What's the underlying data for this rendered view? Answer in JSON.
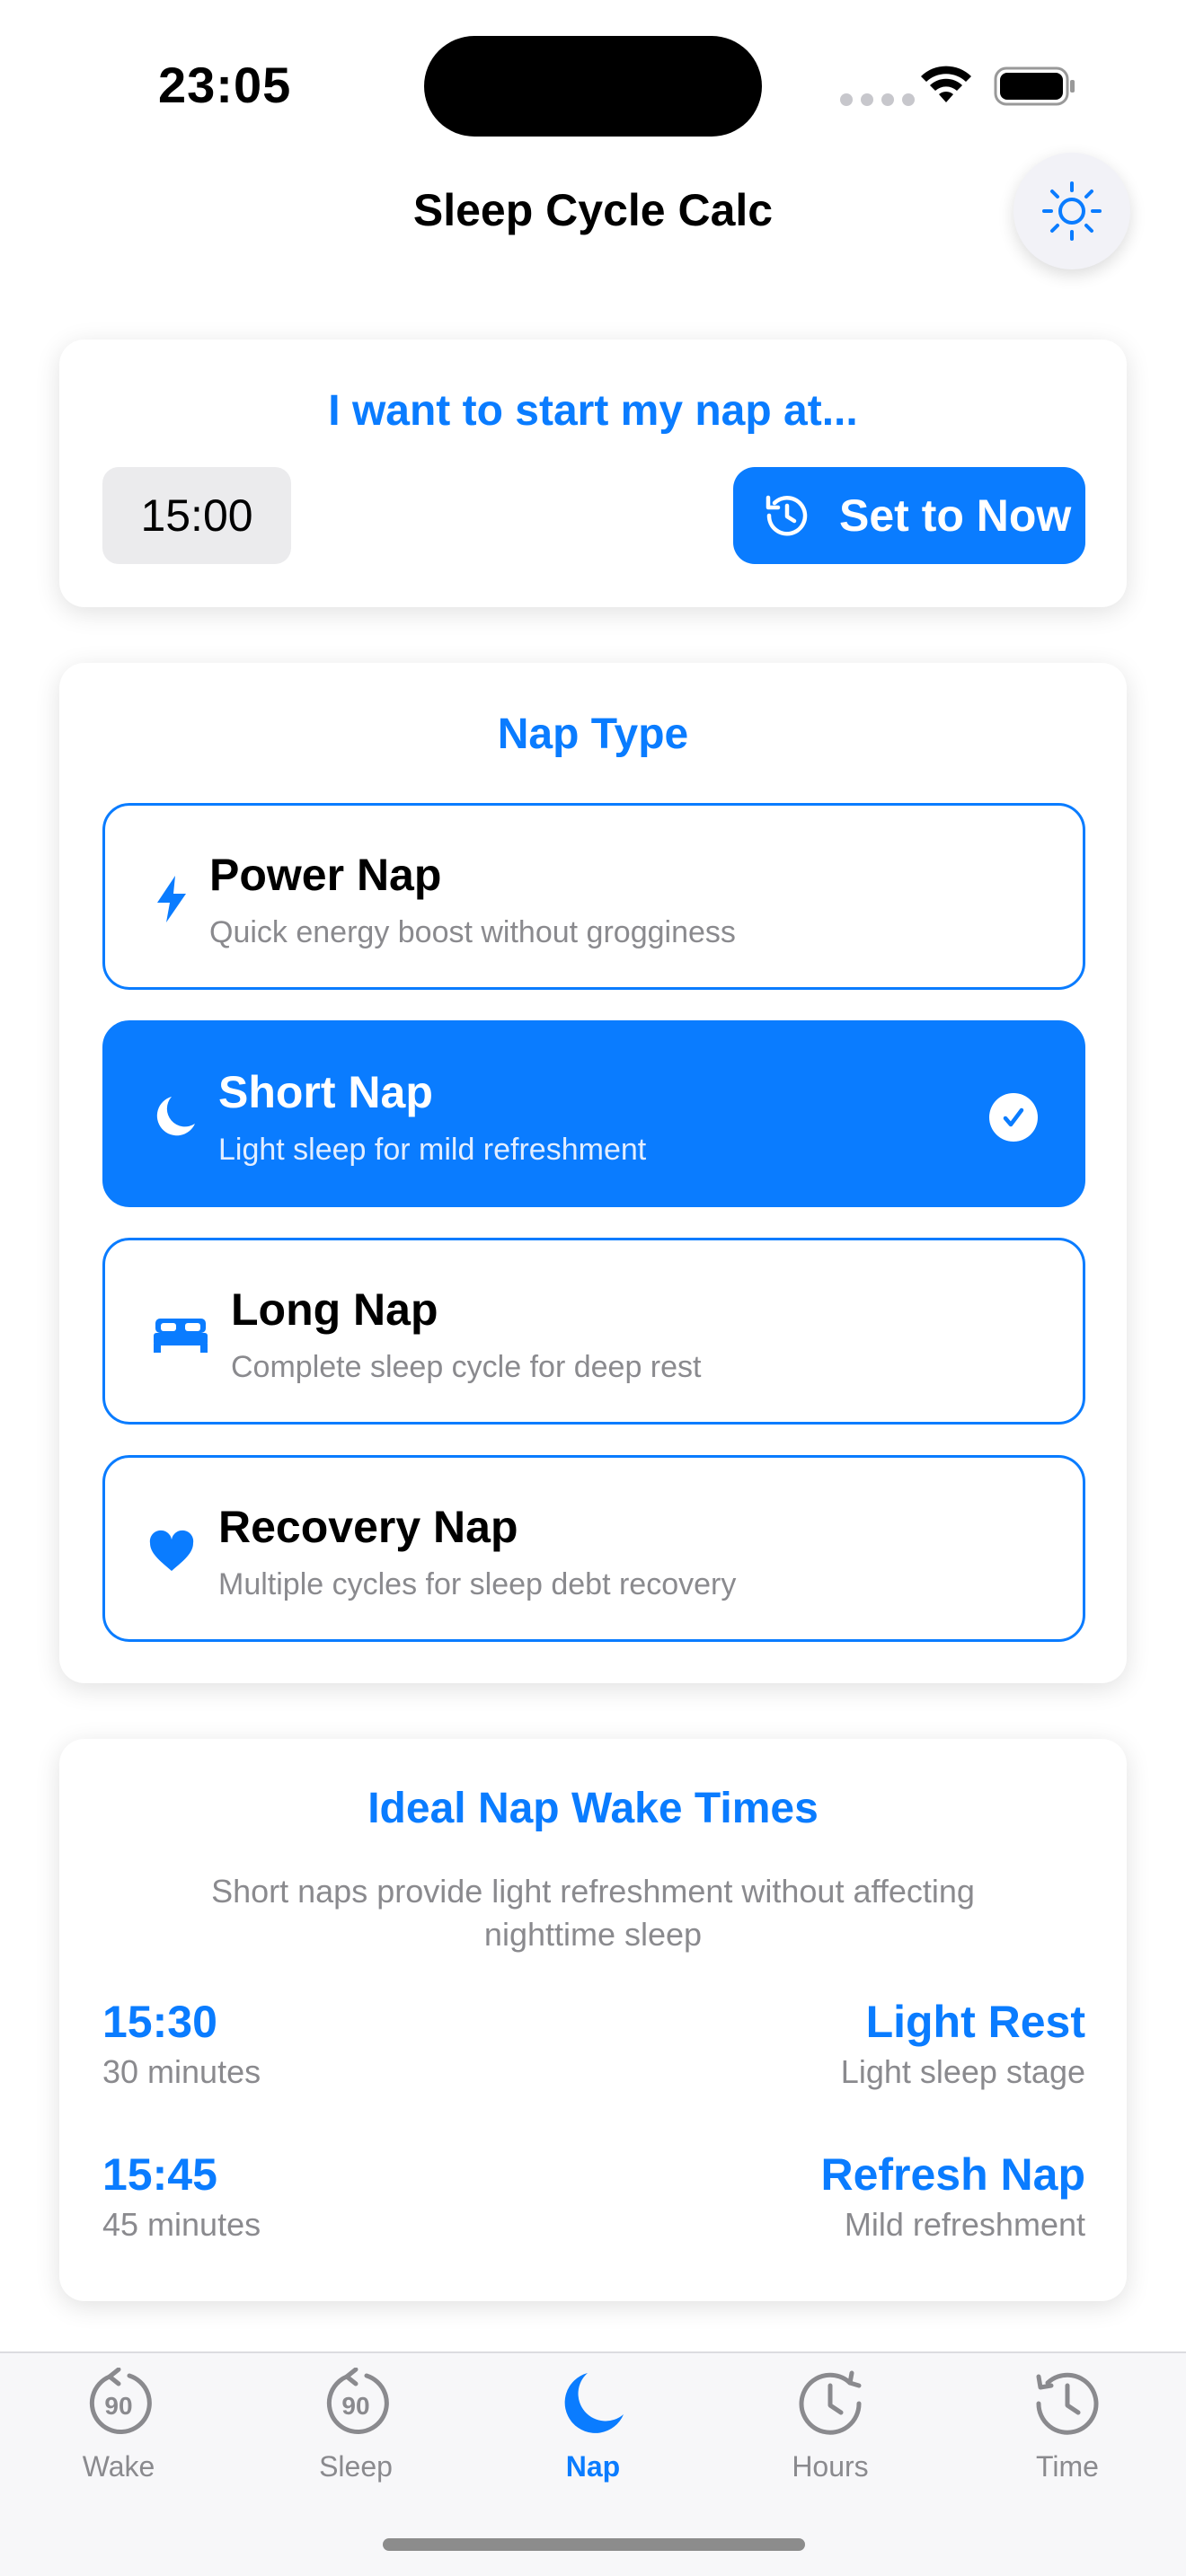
{
  "status_bar": {
    "time": "23:05"
  },
  "nav": {
    "title": "Sleep Cycle Calc",
    "theme_icon": "sun-icon"
  },
  "start_card": {
    "title": "I want to start my nap at...",
    "time_value": "15:00",
    "now_button": "Set to Now"
  },
  "nap_type_card": {
    "title": "Nap Type",
    "options": [
      {
        "title": "Power Nap",
        "desc": "Quick energy boost without grogginess",
        "icon": "bolt-icon",
        "selected": false
      },
      {
        "title": "Short Nap",
        "desc": "Light sleep for mild refreshment",
        "icon": "moon-icon",
        "selected": true
      },
      {
        "title": "Long Nap",
        "desc": "Complete sleep cycle for deep rest",
        "icon": "bed-icon",
        "selected": false
      },
      {
        "title": "Recovery Nap",
        "desc": "Multiple cycles for sleep debt recovery",
        "icon": "heart-icon",
        "selected": false
      }
    ]
  },
  "wake_times_card": {
    "title": "Ideal Nap Wake Times",
    "subtitle": "Short naps provide light refreshment without affecting nighttime sleep",
    "rows": [
      {
        "time": "15:30",
        "duration": "30 minutes",
        "label": "Light Rest",
        "stage": "Light sleep stage"
      },
      {
        "time": "15:45",
        "duration": "45 minutes",
        "label": "Refresh Nap",
        "stage": "Mild refreshment"
      }
    ]
  },
  "tabbar": {
    "tabs": [
      {
        "label": "Wake",
        "icon": "cycle-90-icon",
        "active": false
      },
      {
        "label": "Sleep",
        "icon": "cycle-90-icon",
        "active": false
      },
      {
        "label": "Nap",
        "icon": "moon-icon",
        "active": true
      },
      {
        "label": "Hours",
        "icon": "clock-forward-icon",
        "active": false
      },
      {
        "label": "Time",
        "icon": "clock-back-icon",
        "active": false
      }
    ],
    "cycle_number": "90"
  },
  "colors": {
    "accent": "#0a7cff",
    "secondary_text": "#8a8a8e",
    "inactive_tab": "#8a8a8e"
  }
}
